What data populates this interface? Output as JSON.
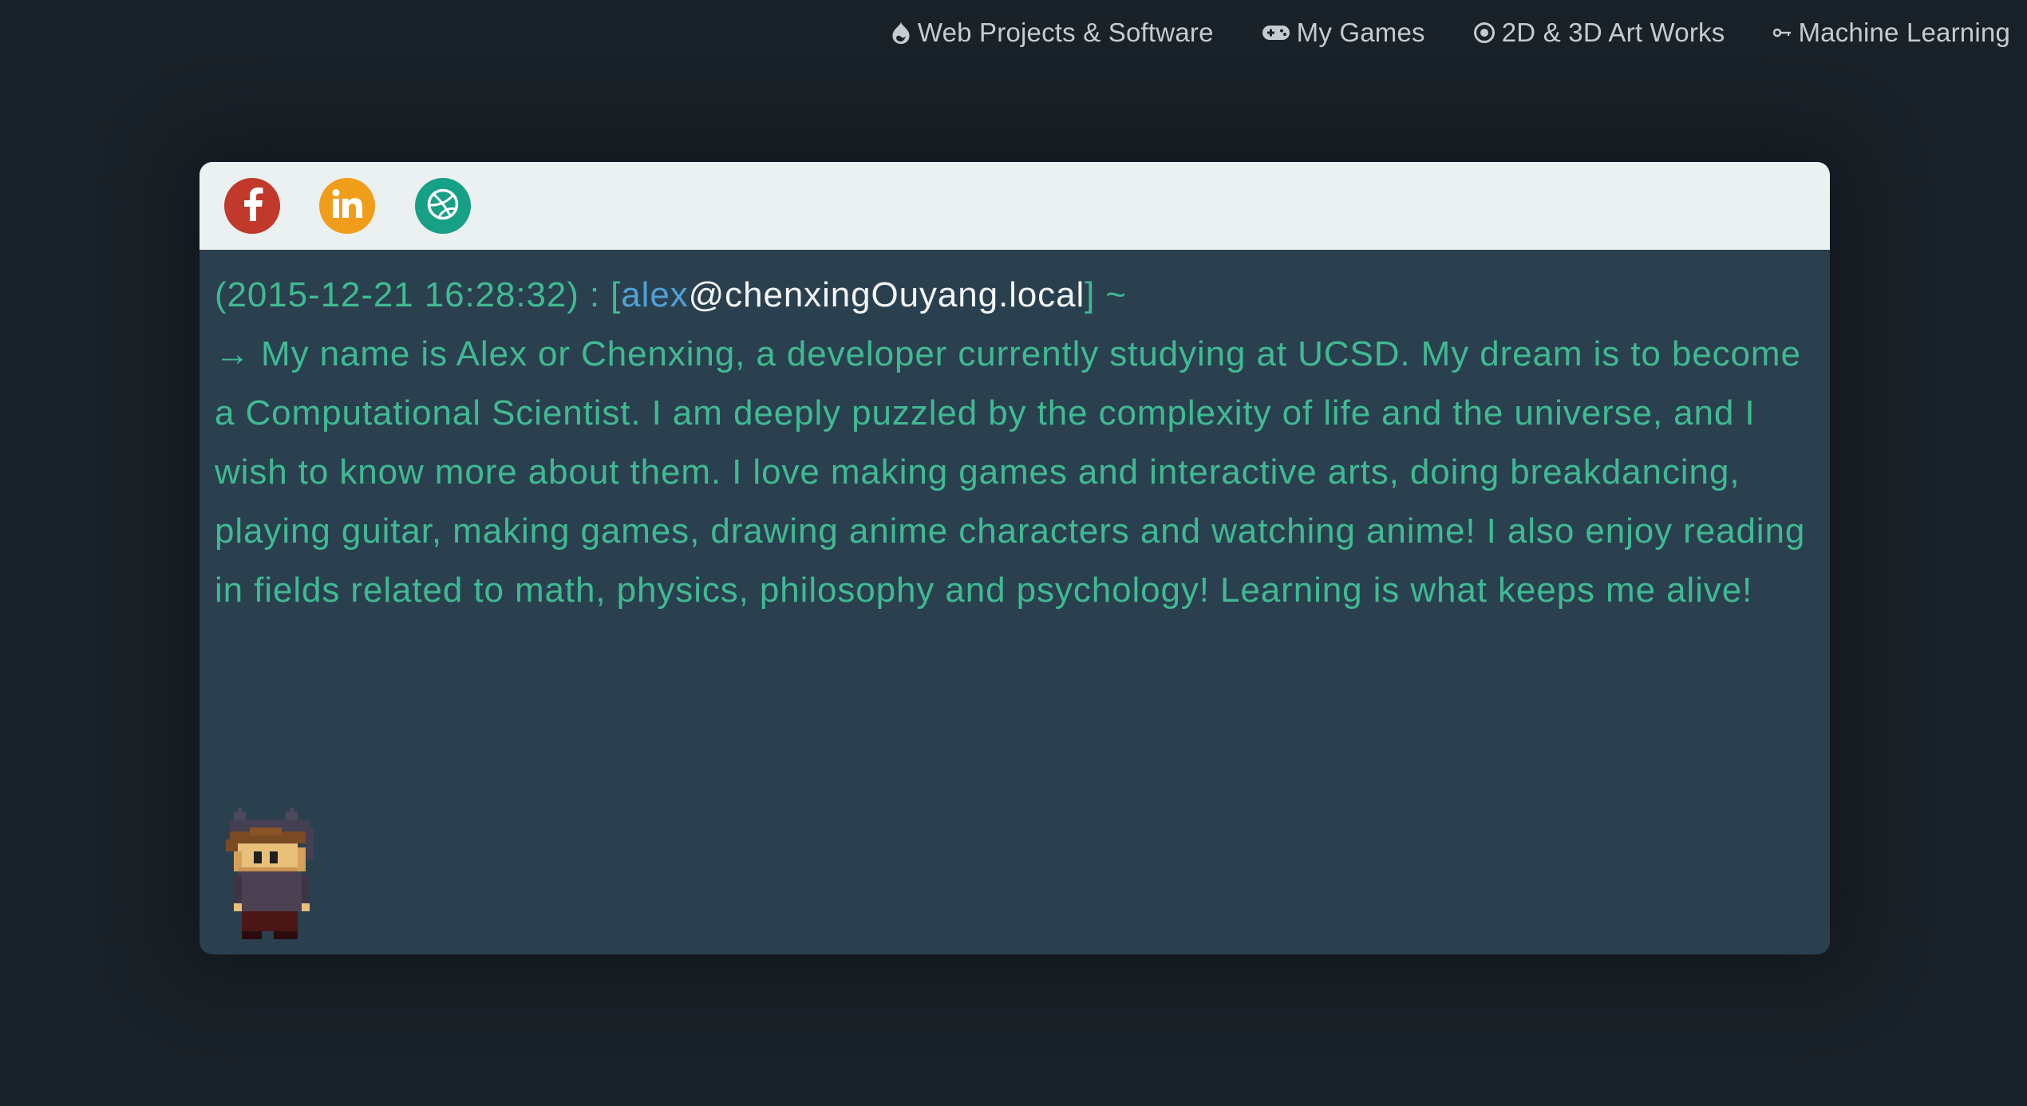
{
  "nav": {
    "items": [
      {
        "label": "Web Projects & Software",
        "icon": "drupal-icon"
      },
      {
        "label": "My Games",
        "icon": "gamepad-icon"
      },
      {
        "label": "2D & 3D Art Works",
        "icon": "target-icon"
      },
      {
        "label": "Machine Learning",
        "icon": "key-icon"
      }
    ]
  },
  "social": [
    {
      "name": "facebook",
      "icon": "facebook-icon",
      "color": "#c0392b"
    },
    {
      "name": "linkedin",
      "icon": "linkedin-icon",
      "color": "#f09d1a"
    },
    {
      "name": "dribbble",
      "icon": "dribbble-icon",
      "color": "#16a085"
    }
  ],
  "terminal": {
    "timestamp": "(2015-12-21 16:28:32)",
    "separator": " : [",
    "user": "alex",
    "host": "@chenxingOuyang.local",
    "suffix": "] ~",
    "arrow": "→",
    "message": "My name is Alex or Chenxing, a developer currently studying at UCSD. My dream is to become a Computational Scientist. I am deeply puzzled by the complexity of life and the universe, and I wish to know more about them. I love making games and interactive arts, doing breakdancing, playing guitar, making games, drawing anime characters and watching anime! I also enjoy reading in fields related to math, physics, philosophy and psychology! Learning is what keeps me alive!"
  },
  "colors": {
    "background": "#1a2229",
    "terminal_body": "#2b404f",
    "titlebar": "#ebf0f1",
    "text": "#3fba92",
    "user": "#4fa1d6",
    "host": "#f2f5f6"
  },
  "avatar": {
    "icon": "pixel-character-avatar"
  }
}
